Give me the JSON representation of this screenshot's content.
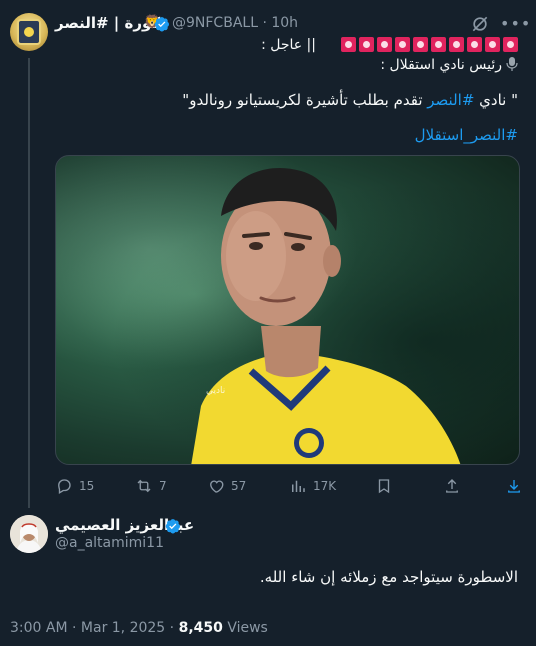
{
  "tweet": {
    "author_name": "كورة | #النصر",
    "author_badge_emoji": "🦁",
    "handle": "@9NFCBALL",
    "time": "10h",
    "urgent_label": "|| عاجل :",
    "flag_count": 10,
    "line2": "رئيس نادي استقلال :",
    "quote_prefix": "\" نادي ",
    "quote_hashtag": "#النصر",
    "quote_rest": " تقدم بطلب تأشيرة لكريستيانو رونالدو\"",
    "hashtag_line": "#النصر_استقلال",
    "photo_watermark": "ناديي",
    "stats": {
      "replies": "15",
      "retweets": "7",
      "likes": "57",
      "views": "17K"
    }
  },
  "reply": {
    "name": "عبدالعزيز العصيمي",
    "handle": "@a_altamimi11",
    "text": "الاسطورة سيتواجد مع زملائه إن شاء الله."
  },
  "meta": {
    "time": "3:00 AM",
    "separator": " · ",
    "date": "Mar 1, 2025",
    "views_count": "8,450",
    "views_label": " Views"
  },
  "colors": {
    "background": "#15202b",
    "accent": "#1d9bf0",
    "muted": "#8b98a5",
    "jersey": "#f2d930"
  }
}
